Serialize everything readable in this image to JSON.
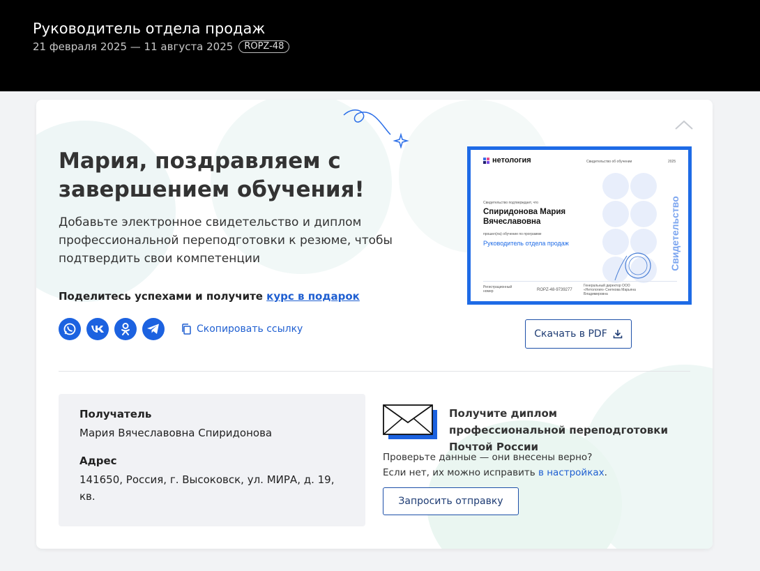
{
  "header": {
    "title": "Руководитель отдела продаж",
    "dates": "21 февраля 2025 — 11 августа 2025",
    "code": "ROPZ-48"
  },
  "congrats": {
    "heading": "Мария, поздравляем с завершением обучения!",
    "lead": "Добавьте электронное свидетельство и диплом профессиональной переподготовки к резюме, чтобы подтвердить свои компетенции",
    "share_text": "Поделитесь успехами и получите ",
    "share_link": "курс в подарок",
    "copy_link": "Скопировать ссылку",
    "socials": [
      "whatsapp-icon",
      "vk-icon",
      "odnoklassniki-icon",
      "telegram-icon"
    ]
  },
  "certificate": {
    "brand": "нетология",
    "cert_label": "Свидетельство об обучении",
    "year": "2025",
    "confirm": "Свидетельство подтверждает, что",
    "name": "Спиридонова Мария Вячеславовна",
    "passed": "прошел(ла) обучение по программе",
    "program": "Руководитель отдела продаж",
    "reg_label": "Регистрационный номер",
    "reg_number": "ROPZ-48-9739277",
    "director": "Генеральный директор ООО «Нетология» Снеткова Марьяна Владимировна",
    "side_text": "Свидетельство",
    "download": "Скачать в PDF"
  },
  "recipient": {
    "label": "Получатель",
    "name": "Мария Вячеславовна Спиридонова",
    "address_label": "Адрес",
    "address": "141650, Россия, г. Высоковск, ул. МИРА, д. 19, кв."
  },
  "post": {
    "title": "Получите диплом профессиональной переподготовки Почтой России",
    "check": "Проверьте данные — они внесены верно?",
    "fix": "Если нет, их можно исправить ",
    "fix_link": "в настройках",
    "fix_end": ".",
    "request_button": "Запросить отправку"
  },
  "colors": {
    "accent": "#1c62e0",
    "button_border": "#1c4fa8",
    "topbar": "#000000"
  }
}
